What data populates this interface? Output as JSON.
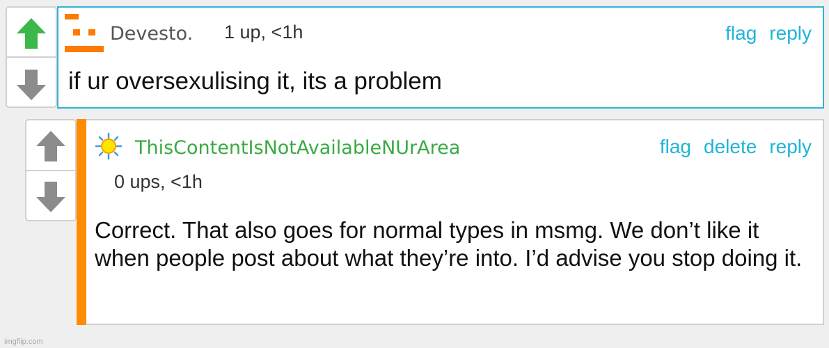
{
  "comments": [
    {
      "author": "Devesto.",
      "meta": "1 up, <1h",
      "actions": [
        "flag",
        "reply"
      ],
      "text": "if ur oversexulising it, its a problem",
      "upvoted": true
    },
    {
      "author": "ThisContentIsNotAvailableNUrArea",
      "meta": "0 ups, <1h",
      "actions": [
        "flag",
        "delete",
        "reply"
      ],
      "text": "Correct. That also goes for normal types in msmg. We don’t like it when people post about what they’re into. I’d advise you stop doing it.",
      "upvoted": false
    }
  ],
  "colors": {
    "link": "#1fb4d9",
    "upvote_active": "#3cb84a",
    "arrow_inactive": "#8c8c8c",
    "highlight_border": "#2bb6d6",
    "reply_bar": "#ff8c00",
    "author2_name": "#3aaa44",
    "avatar1": "#ff7a00",
    "avatar2": "#ffe600"
  },
  "icons": {
    "avatar1": "orange-pixel-face-avatar-icon",
    "avatar2": "yellow-sun-avatar-icon",
    "up": "upvote-arrow-icon",
    "down": "downvote-arrow-icon"
  },
  "watermark": "imgflip.com"
}
